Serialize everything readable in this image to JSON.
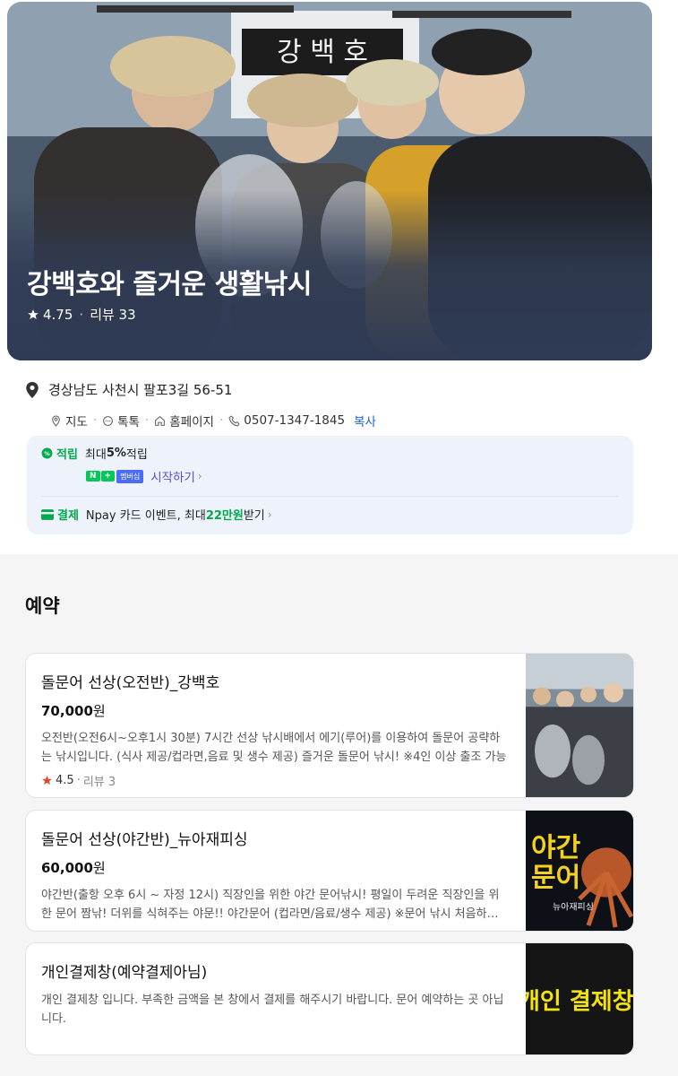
{
  "hero": {
    "boat_sign": "강 백 호",
    "title": "강백호와 즐거운 생활낚시",
    "rating": "4.75",
    "reviews": "리뷰 33"
  },
  "info": {
    "address": "경상남도 사천시 팔포3길 56-51",
    "links": {
      "map": "지도",
      "talk": "톡톡",
      "homepage": "홈페이지",
      "phone": "0507-1347-1845",
      "copy": "복사"
    }
  },
  "benefits": {
    "points": {
      "label": "적립",
      "text_pre": "최대 ",
      "text_strong": "5%",
      "text_post": " 적립",
      "badge_n": "N",
      "badge_plus": "+",
      "badge_membership": "멤버십",
      "start_link": "시작하기"
    },
    "payment": {
      "label": "결제",
      "text_pre": "Npay 카드 이벤트, 최대 ",
      "text_strong": "22만원",
      "text_post": " 받기"
    }
  },
  "reservation": {
    "title": "예약",
    "items": [
      {
        "name": "돌문어 선상(오전반)_강백호",
        "price": "70,000",
        "won": "원",
        "description": "오전반(오전6시~오후1시 30분) 7시간 선상 낚시배에서 에기(루어)를 이용하여 돌문어 공략하는 낚시입니다. (식사 제공/컵라면,음료 및 생수 제공) 즐거운 돌문어 낚시! ※4인 이상 출조 가능",
        "rating": "4.5",
        "reviews": "리뷰 3"
      },
      {
        "name": "돌문어 선상(야간반)_뉴아재피싱",
        "price": "60,000",
        "won": "원",
        "description": "야간반(출항 오후 6시 ~ 자정 12시) 직장인을 위한 야간 문어낚시! 평일이 두려운 직장인을 위한 문어 짬낚! 더위를 식혀주는 야문!! 야간문어 (컵라면/음료/생수 제공) ※문어 낚시 처음하시는 분도 환영",
        "thumb_line1": "야간",
        "thumb_line2": "문어",
        "thumb_small": "뉴아재피싱"
      },
      {
        "name": "개인결제창(예약결제아님)",
        "description": "개인 결제창 입니다. 부족한 금액을 본 창에서 결제를 해주시기 바랍니다. 문어 예약하는 곳 아닙니다.",
        "thumb_text": "개인 결제창"
      }
    ]
  },
  "colors": {
    "accent_green": "#03a94d",
    "link_blue": "#1b64da",
    "star_red": "#e8452c",
    "hero_navy": "#2f3b55"
  }
}
